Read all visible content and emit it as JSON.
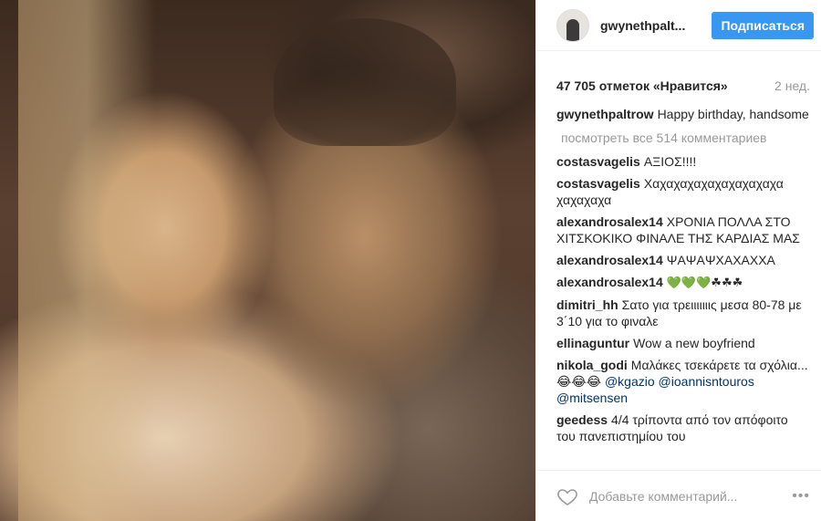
{
  "post": {
    "username": "gwynethpalt...",
    "follow_label": "Подписаться",
    "likes": "47 705 отметок «Нравится»",
    "age": "2 нед.",
    "caption_user": "gwynethpaltrow",
    "caption_text": "Happy birthday, handsome",
    "view_all": "посмотреть все 514 комментариев",
    "comments": [
      {
        "user": "costasvagelis",
        "text": "ΑΞΙΟΣ!!!!"
      },
      {
        "user": "costasvagelis",
        "text": "Χαχαχαχαχαχαχαχαχαχα χαχαχαχα"
      },
      {
        "user": "alexandrosalex14",
        "text": "ΧΡΟΝΙΑ ΠΟΛΛΑ ΣΤΟ ΧΙΤΣΚΟΚΙΚΟ ΦΙΝΑΛΕ ΤΗΣ ΚΑΡΔΙΑΣ ΜΑΣ"
      },
      {
        "user": "alexandrosalex14",
        "text": "ΨΑΨΑΨΧΑΧΑΧΧΑ"
      },
      {
        "user": "alexandrosalex14",
        "text": "💚💚💚☘☘☘"
      },
      {
        "user": "dimitri_hh",
        "text": "Σατο για τρειιιιιιις μεσα 80-78 με 3΄10 για το φιναλε"
      },
      {
        "user": "ellinaguntur",
        "text": "Wow a new boyfriend"
      },
      {
        "user": "nikola_godi",
        "text": "Μαλάκες τσεκάρετε τα σχόλια... 😂😂😂",
        "mentions": [
          "@kgazio",
          "@ioannisntouros",
          "@mitsensen"
        ]
      },
      {
        "user": "geedess",
        "text": "4/4 τρίποντα από τον απόφοιτο του πανεπιστημίου του"
      }
    ],
    "add_comment_placeholder": "Добавьте комментарий...",
    "more": "•••"
  },
  "icons": {
    "heart": "heart-outline-icon",
    "more": "more-horizontal-icon"
  },
  "colors": {
    "follow_button": "#3897f0",
    "mention": "#003569",
    "muted": "#999999"
  }
}
